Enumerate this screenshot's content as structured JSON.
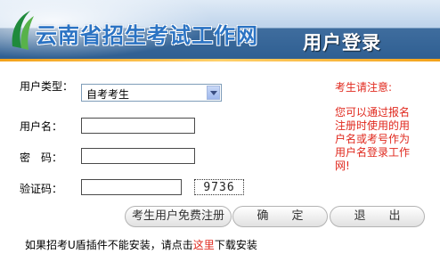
{
  "header": {
    "title": "云南省招生考试工作网",
    "subtitle": "用户登录"
  },
  "form": {
    "user_type_label": "用户类型：",
    "user_type_value": "自考考生",
    "username_label": "用户名：",
    "password_label": "密　码：",
    "captcha_label": "验证码：",
    "captcha_code": "9736"
  },
  "notice": {
    "heading": "考生请注意:",
    "text": "您可以通过报名注册时使用的用户名或考号作为用户名登录工作网!"
  },
  "buttons": {
    "register": "考生用户免费注册",
    "confirm": "确　　定",
    "exit": "退　　出"
  },
  "footer": {
    "before": "如果招考U盾插件不能安装，请点击",
    "link": "这里",
    "after": "下载安装"
  }
}
